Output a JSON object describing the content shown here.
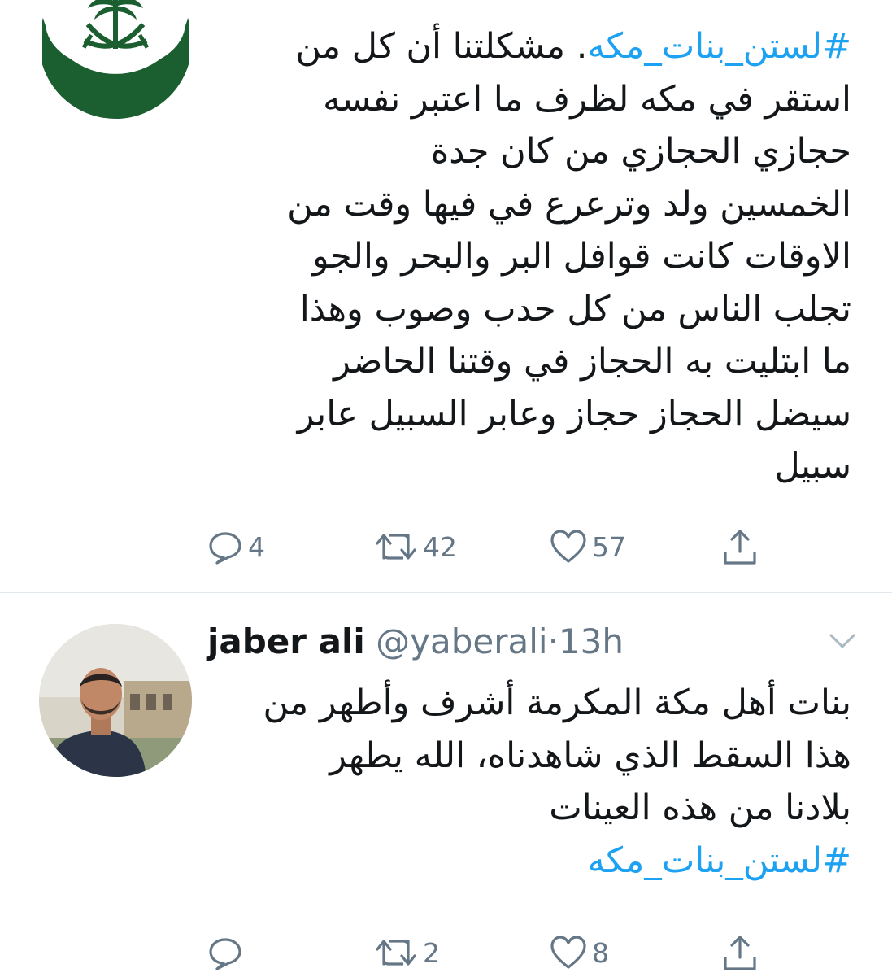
{
  "tweets": [
    {
      "body_lines": [
        {
          "hashtag": "#لستن_بنات_مكه",
          "text": ".  مشكلتنا أن كل من"
        },
        {
          "text": "استقر في مكه لظرف ما اعتبر نفسه"
        },
        {
          "text": "حجازي الحجازي من كان جدة"
        },
        {
          "text": "الخمسين ولد وترعرع في فيها وقت من"
        },
        {
          "text": "الاوقات كانت قوافل البر والبحر والجو"
        },
        {
          "text": "تجلب الناس من كل حدب وصوب وهذا"
        },
        {
          "text": "ما ابتليت به الحجاز في وقتنا الحاضر"
        },
        {
          "text": "سيضل الحجاز حجاز وعابر السبيل عابر"
        },
        {
          "text": "سبيل"
        }
      ],
      "actions": {
        "replies": "4",
        "retweets": "42",
        "likes": "57"
      }
    },
    {
      "name": "jaber ali",
      "handle": "@yaberali",
      "dot": "·",
      "time": "13h",
      "body_lines": [
        {
          "text": "بنات أهل مكة المكرمة أشرف وأطهر من"
        },
        {
          "text": "هذا السقط الذي شاهدناه، الله يطهر"
        },
        {
          "text": "بلادنا من هذه العينات"
        },
        {
          "hashtag": "#لستن_بنات_مكه"
        }
      ],
      "actions": {
        "replies": "",
        "retweets": "2",
        "likes": "8"
      }
    }
  ],
  "icons": {
    "reply": "reply-icon",
    "retweet": "retweet-icon",
    "like": "heart-icon",
    "share": "share-icon",
    "caret": "chevron-down-icon"
  },
  "colors": {
    "link": "#1da1f2",
    "secondary": "#657786",
    "emblem_green": "#1b5e30",
    "divider": "#e1e8ed"
  }
}
